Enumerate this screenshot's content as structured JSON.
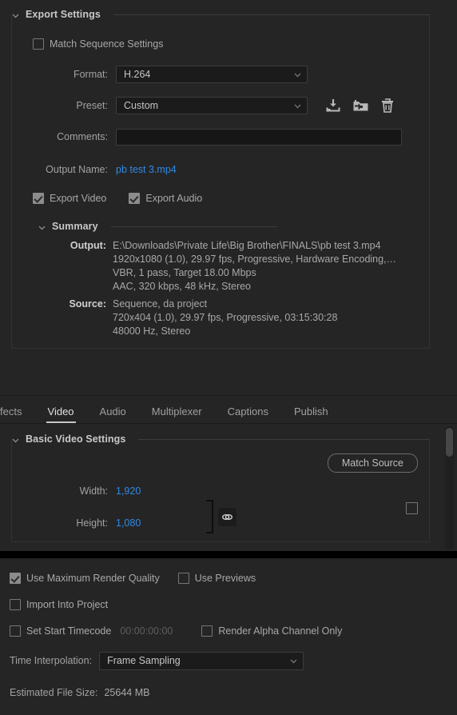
{
  "export_settings": {
    "title": "Export Settings",
    "match_sequence": {
      "label": "Match Sequence Settings",
      "checked": false
    },
    "format": {
      "label": "Format:",
      "value": "H.264"
    },
    "preset": {
      "label": "Preset:",
      "value": "Custom"
    },
    "preset_actions": [
      "save-preset-icon",
      "import-preset-icon",
      "delete-preset-icon"
    ],
    "comments": {
      "label": "Comments:",
      "value": "",
      "placeholder": ""
    },
    "output_name": {
      "label": "Output Name:",
      "value": "pb test 3.mp4"
    },
    "export_video": {
      "label": "Export Video",
      "checked": true
    },
    "export_audio": {
      "label": "Export Audio",
      "checked": true
    },
    "summary": {
      "title": "Summary",
      "output_label": "Output:",
      "output_lines": [
        "E:\\Downloads\\Private Life\\Big Brother\\FINALS\\pb test 3.mp4",
        "1920x1080 (1.0), 29.97 fps, Progressive, Hardware Encoding,…",
        "VBR, 1 pass, Target 18.00 Mbps",
        "AAC, 320 kbps, 48 kHz, Stereo"
      ],
      "source_label": "Source:",
      "source_lines": [
        "Sequence, da project",
        "720x404 (1.0), 29.97 fps, Progressive, 03:15:30:28",
        "48000 Hz, Stereo"
      ]
    }
  },
  "tabs": [
    {
      "label": "Effects",
      "active": false
    },
    {
      "label": "Video",
      "active": true
    },
    {
      "label": "Audio",
      "active": false
    },
    {
      "label": "Multiplexer",
      "active": false
    },
    {
      "label": "Captions",
      "active": false
    },
    {
      "label": "Publish",
      "active": false
    }
  ],
  "basic_video": {
    "title": "Basic Video Settings",
    "match_source": "Match Source",
    "width": {
      "label": "Width:",
      "value": "1,920"
    },
    "height": {
      "label": "Height:",
      "value": "1,080"
    },
    "link_toggle": "link-icon",
    "reset_checkbox_checked": false
  },
  "bottom": {
    "max_render_quality": {
      "label": "Use Maximum Render Quality",
      "checked": true
    },
    "use_previews": {
      "label": "Use Previews",
      "checked": false
    },
    "import_into_project": {
      "label": "Import Into Project",
      "checked": false
    },
    "set_start_timecode": {
      "label": "Set Start Timecode",
      "checked": false
    },
    "timecode_value": "00:00:00:00",
    "render_alpha": {
      "label": "Render Alpha Channel Only",
      "checked": false
    },
    "time_interpolation": {
      "label": "Time Interpolation:",
      "value": "Frame Sampling"
    },
    "estimated_size": {
      "label": "Estimated File Size:",
      "value": "25644 MB"
    }
  },
  "colors": {
    "background": "#252525",
    "link": "#2f8ae6",
    "text": "#a8a8a8",
    "field_bg": "#1b1b1b"
  }
}
